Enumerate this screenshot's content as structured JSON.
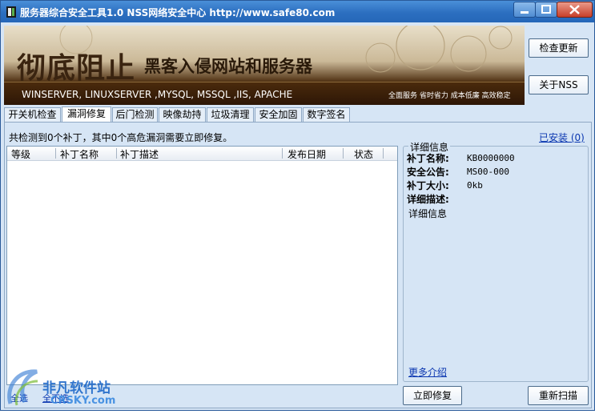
{
  "window": {
    "title": "服务器综合安全工具1.0  NSS网络安全中心 http://www.safe80.com",
    "accent": "#2c6fc0"
  },
  "banner": {
    "headline": "彻底阻止",
    "subheadline": "黑客入侵网站和服务器",
    "tech": "WINSERVER, LINUXSERVER ,MYSQL, MSSQL ,IIS, APACHE",
    "slogan": "全面服务 省时省力 成本低廉 高效稳定"
  },
  "side_buttons": {
    "check_update": "检查更新",
    "about": "关于NSS"
  },
  "tabs": [
    "开关机检查",
    "漏洞修复",
    "后门检测",
    "映像劫持",
    "垃圾清理",
    "安全加固",
    "数字签名"
  ],
  "active_tab": "漏洞修复",
  "status": {
    "message": "共检测到0个补丁，其中0个高危漏洞需要立即修复。",
    "installed_link": "已安装 (0)"
  },
  "table": {
    "columns": [
      "等级",
      "补丁名称",
      "补丁描述",
      "发布日期",
      "状态"
    ],
    "rows": []
  },
  "details": {
    "title": "详细信息",
    "patch_name_label": "补丁名称:",
    "patch_name_value": "KB0000000",
    "bulletin_label": "安全公告:",
    "bulletin_value": "MS00-000",
    "size_label": "补丁大小:",
    "size_value": "0kb",
    "desc_label": "详细描述:",
    "desc_value": "详细信息",
    "more_link": "更多介绍"
  },
  "footer": {
    "select_all": "全选",
    "select_none": "全不选",
    "fix_now": "立即修复",
    "rescan": "重新扫描"
  },
  "watermark": {
    "name": "非凡软件站",
    "site": "CRSKY.com"
  }
}
